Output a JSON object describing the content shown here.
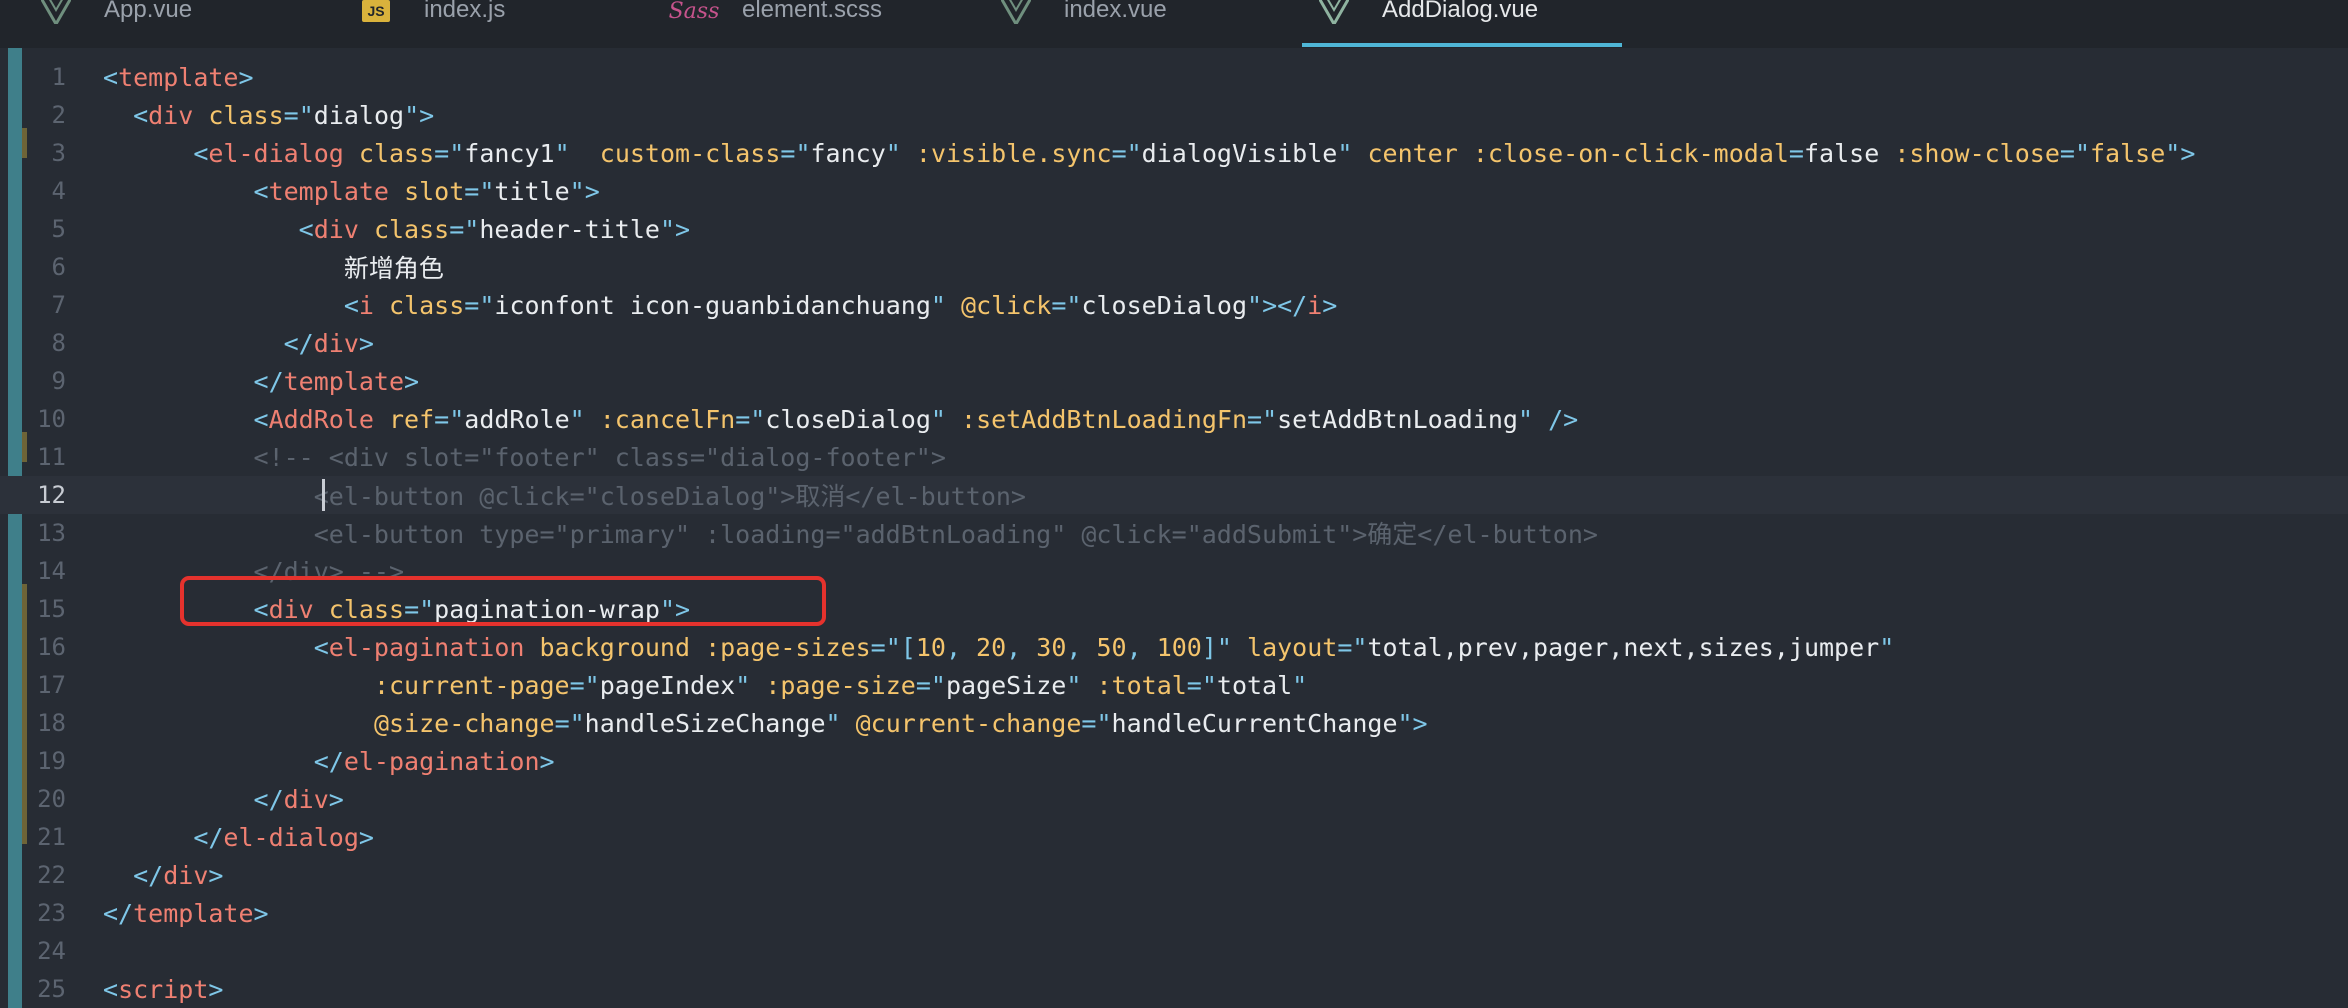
{
  "tabs": [
    {
      "label": "App.vue",
      "icon": "vue-icon",
      "active": false
    },
    {
      "label": "index.js",
      "icon": "js-icon",
      "active": false
    },
    {
      "label": "element.scss",
      "icon": "sass-icon",
      "active": false
    },
    {
      "label": "index.vue",
      "icon": "vue-icon",
      "active": false
    },
    {
      "label": "AddDialog.vue",
      "icon": "vue-icon",
      "active": true
    }
  ],
  "js_badge": "JS",
  "sass_badge": "Sass",
  "colors": {
    "background": "#272c34",
    "tag": "#ef8072",
    "attribute": "#f4c46c",
    "punctuation": "#7fc7e8",
    "string": "#e9ecef",
    "comment": "#5b636e",
    "highlight_box": "#e5322d",
    "active_tab_underline": "#4fb6d6"
  },
  "editor": {
    "current_line": 12,
    "lines": [
      {
        "n": "1",
        "indent": "",
        "tokens": [
          [
            "p",
            "<"
          ],
          [
            "tag",
            "template"
          ],
          [
            "p",
            ">"
          ]
        ]
      },
      {
        "n": "2",
        "indent": "  ",
        "tokens": [
          [
            "p",
            "<"
          ],
          [
            "tag",
            "div"
          ],
          [
            "s",
            " "
          ],
          [
            "attr",
            "class"
          ],
          [
            "p",
            "=\""
          ],
          [
            "str",
            "dialog"
          ],
          [
            "p",
            "\">"
          ]
        ]
      },
      {
        "n": "3",
        "indent": "      ",
        "tokens": [
          [
            "p",
            "<"
          ],
          [
            "tag",
            "el-dialog"
          ],
          [
            "s",
            " "
          ],
          [
            "attr",
            "class"
          ],
          [
            "p",
            "=\""
          ],
          [
            "str",
            "fancy1"
          ],
          [
            "p",
            "\""
          ],
          [
            "s",
            "  "
          ],
          [
            "attr",
            "custom-class"
          ],
          [
            "p",
            "=\""
          ],
          [
            "str",
            "fancy"
          ],
          [
            "p",
            "\""
          ],
          [
            "s",
            " "
          ],
          [
            "attr",
            ":visible.sync"
          ],
          [
            "p",
            "=\""
          ],
          [
            "str",
            "dialogVisible"
          ],
          [
            "p",
            "\""
          ],
          [
            "s",
            " "
          ],
          [
            "attr",
            "center"
          ],
          [
            "s",
            " "
          ],
          [
            "attr",
            ":close-on-click-modal"
          ],
          [
            "p",
            "="
          ],
          [
            "str",
            "false"
          ],
          [
            "s",
            " "
          ],
          [
            "attr",
            ":show-close"
          ],
          [
            "p",
            "=\""
          ],
          [
            "attr",
            "false"
          ],
          [
            "p",
            "\">"
          ]
        ]
      },
      {
        "n": "4",
        "indent": "          ",
        "tokens": [
          [
            "p",
            "<"
          ],
          [
            "tag",
            "template"
          ],
          [
            "s",
            " "
          ],
          [
            "attr",
            "slot"
          ],
          [
            "p",
            "=\""
          ],
          [
            "str",
            "title"
          ],
          [
            "p",
            "\">"
          ]
        ]
      },
      {
        "n": "5",
        "indent": "             ",
        "tokens": [
          [
            "p",
            "<"
          ],
          [
            "tag",
            "div"
          ],
          [
            "s",
            " "
          ],
          [
            "attr",
            "class"
          ],
          [
            "p",
            "=\""
          ],
          [
            "str",
            "header-title"
          ],
          [
            "p",
            "\">"
          ]
        ]
      },
      {
        "n": "6",
        "indent": "                ",
        "tokens": [
          [
            "cjk",
            "新增角色"
          ]
        ]
      },
      {
        "n": "7",
        "indent": "                ",
        "tokens": [
          [
            "p",
            "<"
          ],
          [
            "tag",
            "i"
          ],
          [
            "s",
            " "
          ],
          [
            "attr",
            "class"
          ],
          [
            "p",
            "=\""
          ],
          [
            "str",
            "iconfont icon-guanbidanchuang"
          ],
          [
            "p",
            "\""
          ],
          [
            "s",
            " "
          ],
          [
            "attr",
            "@click"
          ],
          [
            "p",
            "=\""
          ],
          [
            "str",
            "closeDialog"
          ],
          [
            "p",
            "\"></"
          ],
          [
            "tag",
            "i"
          ],
          [
            "p",
            ">"
          ]
        ]
      },
      {
        "n": "8",
        "indent": "            ",
        "tokens": [
          [
            "p",
            "</"
          ],
          [
            "tag",
            "div"
          ],
          [
            "p",
            ">"
          ]
        ]
      },
      {
        "n": "9",
        "indent": "          ",
        "tokens": [
          [
            "p",
            "</"
          ],
          [
            "tag",
            "template"
          ],
          [
            "p",
            ">"
          ]
        ]
      },
      {
        "n": "10",
        "indent": "          ",
        "tokens": [
          [
            "p",
            "<"
          ],
          [
            "tag",
            "AddRole"
          ],
          [
            "s",
            " "
          ],
          [
            "attr",
            "ref"
          ],
          [
            "p",
            "=\""
          ],
          [
            "str",
            "addRole"
          ],
          [
            "p",
            "\""
          ],
          [
            "s",
            " "
          ],
          [
            "attr",
            ":cancelFn"
          ],
          [
            "p",
            "=\""
          ],
          [
            "str",
            "closeDialog"
          ],
          [
            "p",
            "\""
          ],
          [
            "s",
            " "
          ],
          [
            "attr",
            ":setAddBtnLoadingFn"
          ],
          [
            "p",
            "=\""
          ],
          [
            "str",
            "setAddBtnLoading"
          ],
          [
            "p",
            "\""
          ],
          [
            "s",
            " "
          ],
          [
            "p",
            "/>"
          ]
        ]
      },
      {
        "n": "11",
        "indent": "          ",
        "tokens": [
          [
            "cmt",
            "<!-- <div slot=\"footer\" class=\"dialog-footer\">"
          ]
        ]
      },
      {
        "n": "12",
        "indent": "              ",
        "tokens": [
          [
            "cmt",
            "<el-button @click=\"closeDialog\">取消</el-button>"
          ]
        ]
      },
      {
        "n": "13",
        "indent": "              ",
        "tokens": [
          [
            "cmt",
            "<el-button type=\"primary\" :loading=\"addBtnLoading\" @click=\"addSubmit\">确定</el-button>"
          ]
        ]
      },
      {
        "n": "14",
        "indent": "          ",
        "tokens": [
          [
            "cmt",
            "</div> -->"
          ]
        ]
      },
      {
        "n": "15",
        "indent": "          ",
        "tokens": [
          [
            "p",
            "<"
          ],
          [
            "tag",
            "div"
          ],
          [
            "s",
            " "
          ],
          [
            "attr",
            "class"
          ],
          [
            "p",
            "=\""
          ],
          [
            "str",
            "pagination-wrap"
          ],
          [
            "p",
            "\">"
          ]
        ]
      },
      {
        "n": "16",
        "indent": "              ",
        "tokens": [
          [
            "p",
            "<"
          ],
          [
            "tag",
            "el-pagination"
          ],
          [
            "s",
            " "
          ],
          [
            "attr",
            "background"
          ],
          [
            "s",
            " "
          ],
          [
            "attr",
            ":page-sizes"
          ],
          [
            "p",
            "=\"["
          ],
          [
            "num",
            "10"
          ],
          [
            "p",
            ", "
          ],
          [
            "num",
            "20"
          ],
          [
            "p",
            ", "
          ],
          [
            "num",
            "30"
          ],
          [
            "p",
            ", "
          ],
          [
            "num",
            "50"
          ],
          [
            "p",
            ", "
          ],
          [
            "num",
            "100"
          ],
          [
            "p",
            "]\""
          ],
          [
            "s",
            " "
          ],
          [
            "attr",
            "layout"
          ],
          [
            "p",
            "=\""
          ],
          [
            "str",
            "total,prev,pager,next,sizes,jumper"
          ],
          [
            "p",
            "\""
          ]
        ]
      },
      {
        "n": "17",
        "indent": "                  ",
        "tokens": [
          [
            "attr",
            ":current-page"
          ],
          [
            "p",
            "=\""
          ],
          [
            "str",
            "pageIndex"
          ],
          [
            "p",
            "\""
          ],
          [
            "s",
            " "
          ],
          [
            "attr",
            ":page-size"
          ],
          [
            "p",
            "=\""
          ],
          [
            "str",
            "pageSize"
          ],
          [
            "p",
            "\""
          ],
          [
            "s",
            " "
          ],
          [
            "attr",
            ":total"
          ],
          [
            "p",
            "=\""
          ],
          [
            "str",
            "total"
          ],
          [
            "p",
            "\""
          ]
        ]
      },
      {
        "n": "18",
        "indent": "                  ",
        "tokens": [
          [
            "attr",
            "@size-change"
          ],
          [
            "p",
            "=\""
          ],
          [
            "str",
            "handleSizeChange"
          ],
          [
            "p",
            "\""
          ],
          [
            "s",
            " "
          ],
          [
            "attr",
            "@current-change"
          ],
          [
            "p",
            "=\""
          ],
          [
            "str",
            "handleCurrentChange"
          ],
          [
            "p",
            "\">"
          ]
        ]
      },
      {
        "n": "19",
        "indent": "              ",
        "tokens": [
          [
            "p",
            "</"
          ],
          [
            "tag",
            "el-pagination"
          ],
          [
            "p",
            ">"
          ]
        ]
      },
      {
        "n": "20",
        "indent": "          ",
        "tokens": [
          [
            "p",
            "</"
          ],
          [
            "tag",
            "div"
          ],
          [
            "p",
            ">"
          ]
        ]
      },
      {
        "n": "21",
        "indent": "      ",
        "tokens": [
          [
            "p",
            "</"
          ],
          [
            "tag",
            "el-dialog"
          ],
          [
            "p",
            ">"
          ]
        ]
      },
      {
        "n": "22",
        "indent": "  ",
        "tokens": [
          [
            "p",
            "</"
          ],
          [
            "tag",
            "div"
          ],
          [
            "p",
            ">"
          ]
        ]
      },
      {
        "n": "23",
        "indent": "",
        "tokens": [
          [
            "p",
            "</"
          ],
          [
            "tag",
            "template"
          ],
          [
            "p",
            ">"
          ]
        ]
      },
      {
        "n": "24",
        "indent": "",
        "tokens": []
      },
      {
        "n": "25",
        "indent": "",
        "tokens": [
          [
            "p",
            "<"
          ],
          [
            "tag",
            "script"
          ],
          [
            "p",
            ">"
          ]
        ]
      }
    ]
  }
}
